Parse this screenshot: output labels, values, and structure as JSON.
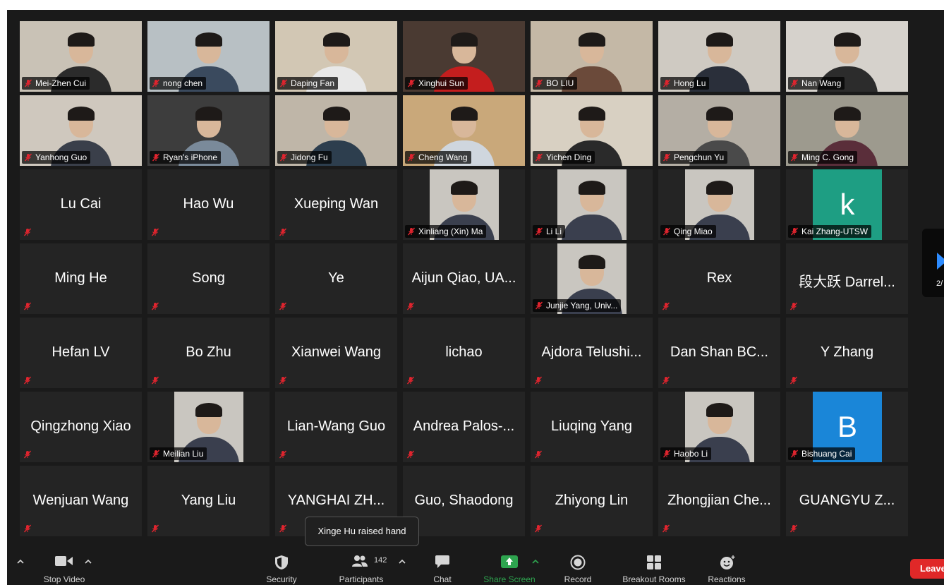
{
  "gallery": {
    "tiles": [
      {
        "name": "Mei-Zhen Cui",
        "video": true
      },
      {
        "name": "nong chen",
        "video": true
      },
      {
        "name": "Daping Fan",
        "video": true
      },
      {
        "name": "Xinghui Sun",
        "video": true
      },
      {
        "name": "BO LIU",
        "video": true
      },
      {
        "name": "Hong Lu",
        "video": true
      },
      {
        "name": "Nan Wang",
        "video": true
      },
      {
        "name": "Yanhong Guo",
        "video": true
      },
      {
        "name": "Ryan's iPhone",
        "video": true
      },
      {
        "name": "Jidong Fu",
        "video": true
      },
      {
        "name": "Cheng Wang",
        "video": true
      },
      {
        "name": "Yichen Ding",
        "video": true
      },
      {
        "name": "Pengchun Yu",
        "video": true
      },
      {
        "name": "Ming C. Gong",
        "video": true
      },
      {
        "name": "Lu Cai",
        "video": false
      },
      {
        "name": "Hao Wu",
        "video": false
      },
      {
        "name": "Xueping Wan",
        "video": false
      },
      {
        "name": "Xinliang (Xin) Ma",
        "video": false,
        "photo": true
      },
      {
        "name": "Li Li",
        "video": false,
        "photo": true
      },
      {
        "name": "Qing Miao",
        "video": false,
        "photo": true
      },
      {
        "name": "Kai Zhang-UTSW",
        "video": false,
        "letter": "k",
        "letter_color": "#1e9e83"
      },
      {
        "name": "Ming He",
        "video": false
      },
      {
        "name": "Song",
        "video": false
      },
      {
        "name": "Ye",
        "video": false
      },
      {
        "name": "Aijun Qiao, UA...",
        "video": false
      },
      {
        "name": "Junjie Yang, Univ...",
        "video": false,
        "photo": true
      },
      {
        "name": "Rex",
        "video": false
      },
      {
        "name": "段大跃 Darrel...",
        "video": false
      },
      {
        "name": "Hefan LV",
        "video": false
      },
      {
        "name": "Bo Zhu",
        "video": false
      },
      {
        "name": "Xianwei Wang",
        "video": false
      },
      {
        "name": "lichao",
        "video": false
      },
      {
        "name": "Ajdora Telushi...",
        "video": false
      },
      {
        "name": "Dan Shan BC...",
        "video": false
      },
      {
        "name": "Y Zhang",
        "video": false
      },
      {
        "name": "Qingzhong Xiao",
        "video": false
      },
      {
        "name": "Meilian Liu",
        "video": false,
        "photo": true
      },
      {
        "name": "Lian-Wang Guo",
        "video": false
      },
      {
        "name": "Andrea Palos-...",
        "video": false
      },
      {
        "name": "Liuqing Yang",
        "video": false
      },
      {
        "name": "Haobo Li",
        "video": false,
        "photo": true
      },
      {
        "name": "Bishuang Cai",
        "video": false,
        "letter": "B",
        "letter_color": "#1a86d8"
      },
      {
        "name": "Wenjuan Wang",
        "video": false
      },
      {
        "name": "Yang Liu",
        "video": false
      },
      {
        "name": "YANGHAI ZH...",
        "video": false
      },
      {
        "name": "Guo, Shaodong",
        "video": false
      },
      {
        "name": "Zhiyong Lin",
        "video": false
      },
      {
        "name": "Zhongjian Che...",
        "video": false
      },
      {
        "name": "GUANGYU Z...",
        "video": false
      }
    ]
  },
  "pager": {
    "page": "2/"
  },
  "tooltip": {
    "text": "Xinge Hu raised hand"
  },
  "toolbar": {
    "stop_video": "Stop Video",
    "security": "Security",
    "participants": "Participants",
    "participant_count": "142",
    "chat": "Chat",
    "share_screen": "Share Screen",
    "record": "Record",
    "breakout_rooms": "Breakout Rooms",
    "reactions": "Reactions",
    "leave": "Leave"
  },
  "colors": {
    "share_green": "#2ea44f",
    "mute_red": "#e0242e",
    "accent_blue": "#2d8cff"
  }
}
